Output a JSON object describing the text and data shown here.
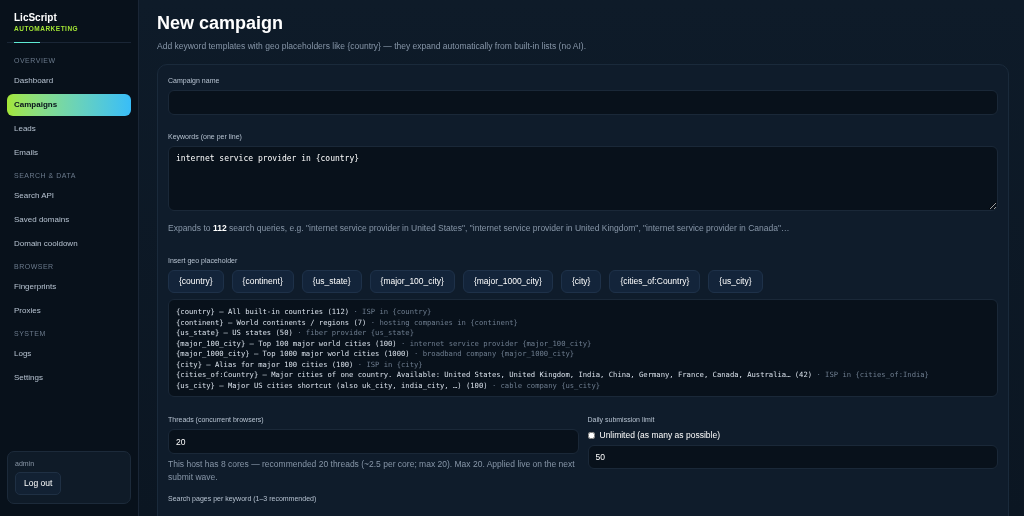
{
  "brand": {
    "name": "LicScript",
    "tagline": "AUTOMARKETING"
  },
  "sidebar": {
    "groups": [
      {
        "label": "OVERVIEW",
        "items": [
          {
            "label": "Dashboard",
            "selected": false
          },
          {
            "label": "Campaigns",
            "selected": true
          },
          {
            "label": "Leads",
            "selected": false
          },
          {
            "label": "Emails",
            "selected": false
          }
        ]
      },
      {
        "label": "SEARCH & DATA",
        "items": [
          {
            "label": "Search API",
            "selected": false
          },
          {
            "label": "Saved domains",
            "selected": false
          },
          {
            "label": "Domain cooldown",
            "selected": false
          }
        ]
      },
      {
        "label": "BROWSER",
        "items": [
          {
            "label": "Fingerprints",
            "selected": false
          },
          {
            "label": "Proxies",
            "selected": false
          }
        ]
      },
      {
        "label": "SYSTEM",
        "items": [
          {
            "label": "Logs",
            "selected": false
          },
          {
            "label": "Settings",
            "selected": false
          }
        ]
      }
    ],
    "user": {
      "name": "admin",
      "logout": "Log out"
    }
  },
  "page": {
    "title": "New campaign",
    "subtitle": "Add keyword templates with geo placeholders like {country} — they expand automatically from built-in lists (no AI)."
  },
  "form": {
    "campaign_name": {
      "label": "Campaign name"
    },
    "keywords": {
      "label": "Keywords (one per line)",
      "value": "internet service provider in {country}"
    },
    "expansion_note": "Expands to **112** search queries, e.g. \"internet service provider in United States\", \"internet service provider in United Kingdom\", \"internet service provider in Canada\"…",
    "placeholders": {
      "label": "Insert geo placeholder",
      "chips": [
        "{country}",
        "{continent}",
        "{us_state}",
        "{major_100_city}",
        "{major_1000_city}",
        "{city}",
        "{cities_of:Country}",
        "{us_city}"
      ],
      "reference": [
        {
          "text": "{country} — All built-in countries (112)",
          "example": "· ISP in {country}"
        },
        {
          "text": "{continent} — World continents / regions (7)",
          "example": "· hosting companies in {continent}"
        },
        {
          "text": "{us_state} — US states (50)",
          "example": "· fiber provider {us_state}"
        },
        {
          "text": "{major_100_city} — Top 100 major world cities (100)",
          "example": "· internet service provider {major_100_city}"
        },
        {
          "text": "{major_1000_city} — Top 1000 major world cities (1000)",
          "example": "· broadband company {major_1000_city}"
        },
        {
          "text": "{city} — Alias for major 100 cities (100)",
          "example": "· ISP in {city}"
        },
        {
          "text": "{cities_of:Country} — Major cities of one country. Available: United States, United Kingdom, India, China, Germany, France, Canada, Australia… (42)",
          "example": "· ISP in {cities_of:India}"
        },
        {
          "text": "{us_city} — Major US cities shortcut (also uk_city, india_city, …) (100)",
          "example": "· cable company {us_city}"
        }
      ]
    },
    "threads": {
      "label": "Threads (concurrent browsers)",
      "value": "20",
      "help": "This host has 8 cores — recommended 20 threads (~2.5 per core; max 20). Max 20. Applied live on the next submit wave."
    },
    "daily_limit": {
      "label": "Daily submission limit",
      "unlimited": {
        "label": "Unlimited (as many as possible)",
        "checked": false
      },
      "value": "50"
    },
    "search_pages": {
      "label": "Search pages per keyword (1–3 recommended)"
    }
  }
}
